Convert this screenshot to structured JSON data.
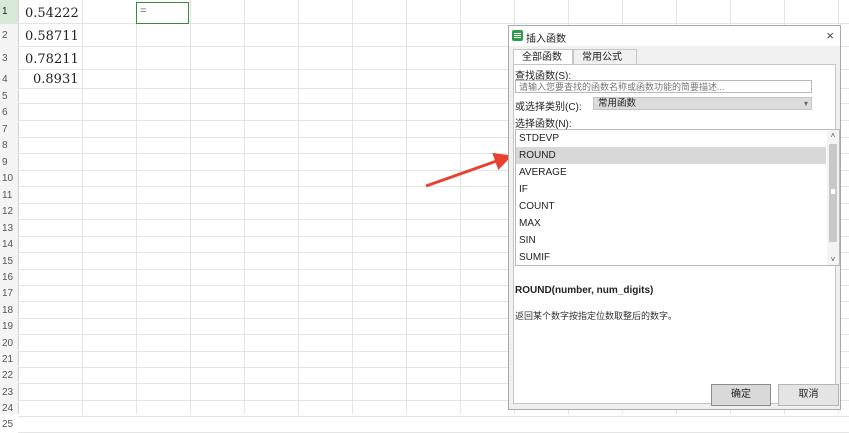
{
  "sheet": {
    "row_numbers": [
      "1",
      "2",
      "3",
      "4",
      "5",
      "6",
      "7",
      "8",
      "9",
      "10",
      "11",
      "12",
      "13",
      "14",
      "15",
      "16",
      "17",
      "18",
      "19",
      "20",
      "21",
      "22",
      "23",
      "24",
      "25"
    ],
    "values": [
      "0.54222",
      "0.58711",
      "0.78211",
      "0.8931"
    ],
    "active_cell_text": "="
  },
  "dialog": {
    "title": "插入函数",
    "close_glyph": "×",
    "tabs": [
      "全部函数",
      "常用公式"
    ],
    "search_label": "查找函数(S):",
    "search_placeholder": "请输入您要查找的函数名称或函数功能的简要描述...",
    "category_label": "或选择类别(C):",
    "category_value": "常用函数",
    "functions_label": "选择函数(N):",
    "functions": [
      "STDEVP",
      "ROUND",
      "AVERAGE",
      "IF",
      "COUNT",
      "MAX",
      "SIN",
      "SUMIF"
    ],
    "selected_function": "ROUND",
    "syntax": "ROUND(number, num_digits)",
    "description": "返回某个数字按指定位数取整后的数字。",
    "ok_label": "确定",
    "cancel_label": "取消"
  },
  "colors": {
    "annotation_arrow": "#e8412f",
    "accent_green": "#2e9b4b"
  },
  "icons": [
    "app-icon",
    "close-icon",
    "dropdown-arrow-icon",
    "scroll-up-icon",
    "scroll-down-icon",
    "mouse-cursor-icon"
  ]
}
